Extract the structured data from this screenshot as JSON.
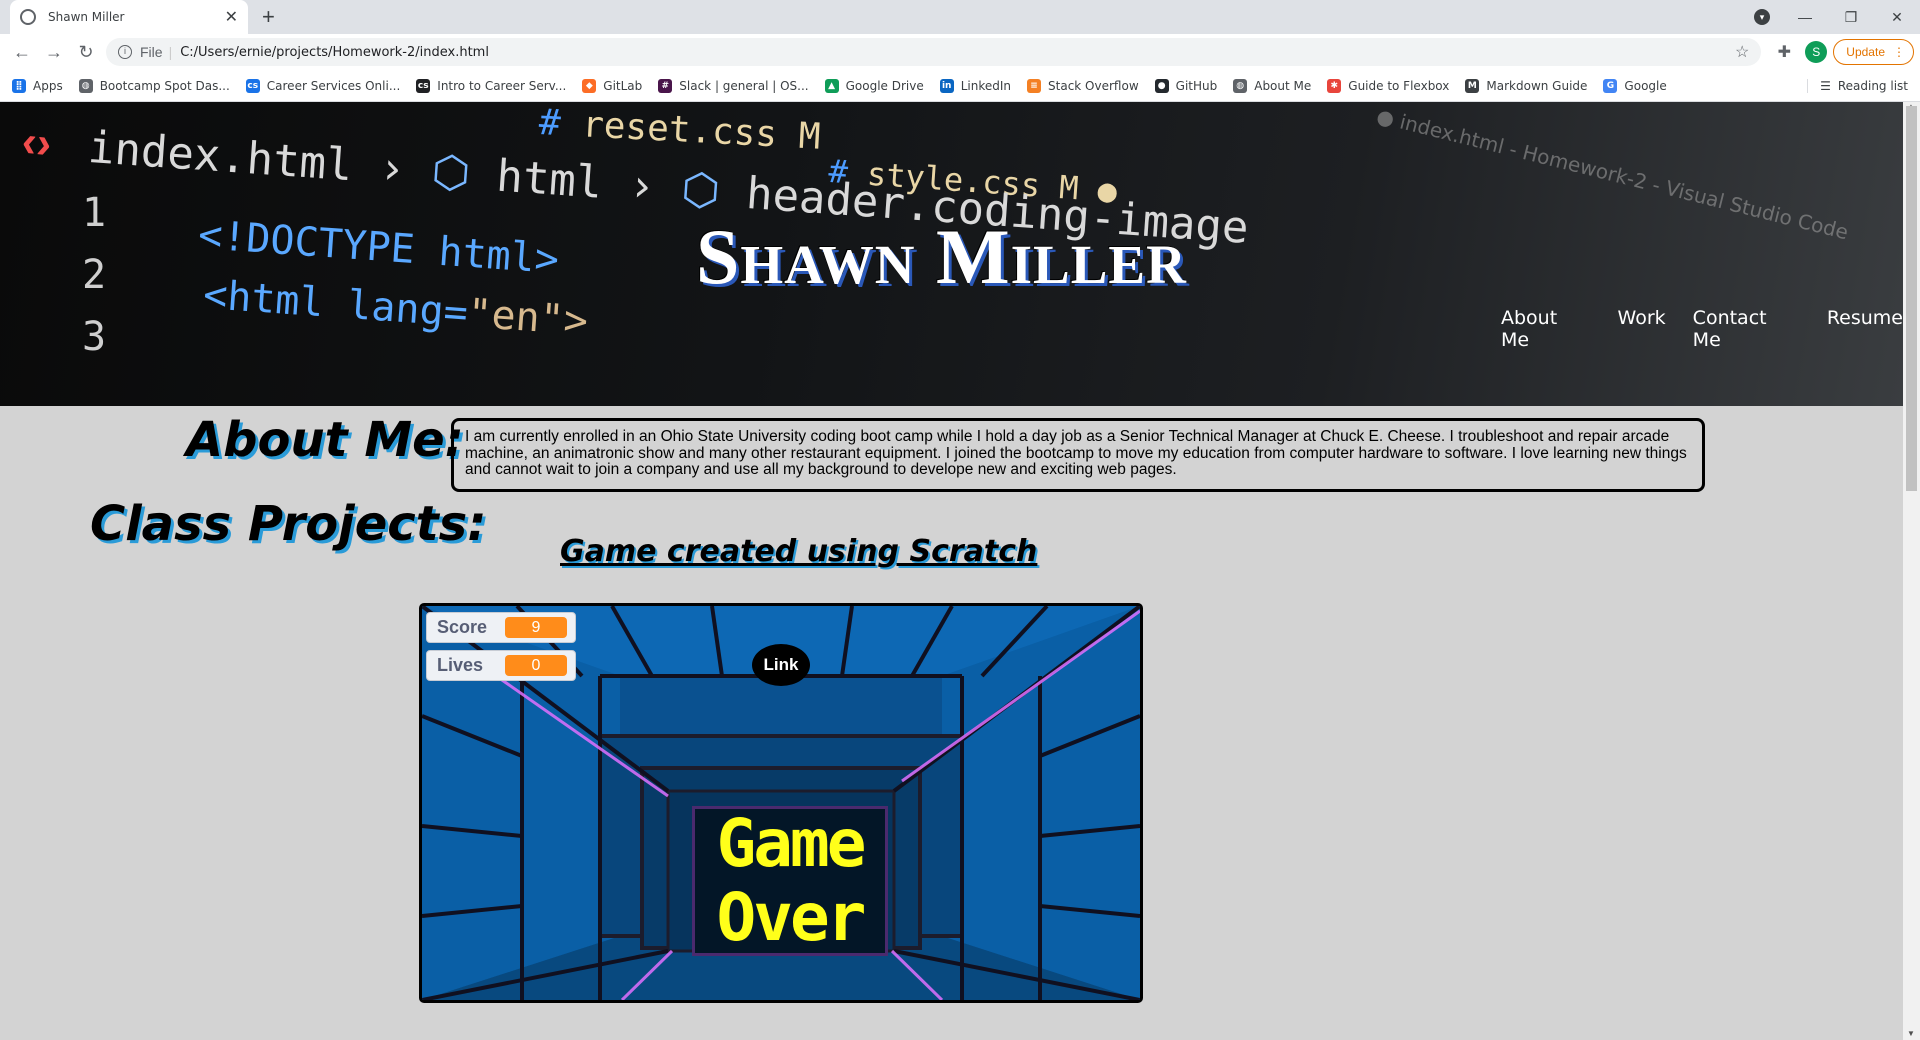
{
  "browser": {
    "tab_title": "Shawn Miller",
    "new_tab": "+",
    "file_label": "File",
    "url": "C:/Users/ernie/projects/Homework-2/index.html",
    "avatar_letter": "S",
    "update_label": "Update"
  },
  "bookmarks": [
    {
      "label": "Apps",
      "icon": "apps-grid-icon",
      "color": "#1a73e8"
    },
    {
      "label": "Bootcamp Spot Das...",
      "icon": "globe-icon",
      "color": "#5f6368"
    },
    {
      "label": "Career Services Onli...",
      "icon": "cs-icon",
      "color": "#1a73e8"
    },
    {
      "label": "Intro to Career Serv...",
      "icon": "cs-icon",
      "color": "#202124"
    },
    {
      "label": "GitLab",
      "icon": "gitlab-icon",
      "color": "#fc6d26"
    },
    {
      "label": "Slack | general | OS...",
      "icon": "slack-icon",
      "color": "#4a154b"
    },
    {
      "label": "Google Drive",
      "icon": "drive-icon",
      "color": "#0f9d58"
    },
    {
      "label": "LinkedIn",
      "icon": "linkedin-icon",
      "color": "#0a66c2"
    },
    {
      "label": "Stack Overflow",
      "icon": "stackoverflow-icon",
      "color": "#f48024"
    },
    {
      "label": "GitHub",
      "icon": "github-icon",
      "color": "#24292e"
    },
    {
      "label": "About Me",
      "icon": "globe-icon",
      "color": "#5f6368"
    },
    {
      "label": "Guide to Flexbox",
      "icon": "star-burst-icon",
      "color": "#e8453c"
    },
    {
      "label": "Markdown Guide",
      "icon": "markdown-icon",
      "color": "#3c4043"
    },
    {
      "label": "Google",
      "icon": "google-icon",
      "color": "#4285f4"
    }
  ],
  "reading_list": "Reading list",
  "hero": {
    "title": "Shawn Miller",
    "code_lines": {
      "breadcrumb_a": "index.html",
      "breadcrumb_b": "html",
      "breadcrumb_c": "header.coding-image",
      "reset_tab": "reset.css M",
      "style_tab": "style.css M",
      "doctype": "<!DOCTYPE html>",
      "html_open": "<html lang=",
      "lang_val": "\"en\">",
      "vscode_title": "● index.html - Homework-2 - Visual Studio Code"
    },
    "nav": [
      "About Me",
      "Work",
      "Contact Me",
      "Resume"
    ]
  },
  "about": {
    "heading": "About Me:",
    "text": "I am currently enrolled in an Ohio State University coding boot camp while I hold a day job as a Senior Technical Manager at Chuck E. Cheese. I troubleshoot and repair arcade machine, an animatronic show and many other restaurant equipment. I joined the bootcamp to move my education from computer hardware to software. I love learning new things and cannot wait to join a company and use all my background to develope new and exciting web pages."
  },
  "projects": {
    "heading": "Class Projects:",
    "game_link": "Game created using Scratch",
    "game": {
      "score_label": "Score",
      "score_value": "9",
      "lives_label": "Lives",
      "lives_value": "0",
      "bubble": "Link",
      "game_over_1": "Game",
      "game_over_2": "Over"
    }
  },
  "colors": {
    "page_bg": "#d3d3d3",
    "heading_shadow": "#2a9bd8",
    "title_shadow": "#2a58b8",
    "monitor_value": "#ff8c1a",
    "game_over_text": "#ffff1a"
  }
}
